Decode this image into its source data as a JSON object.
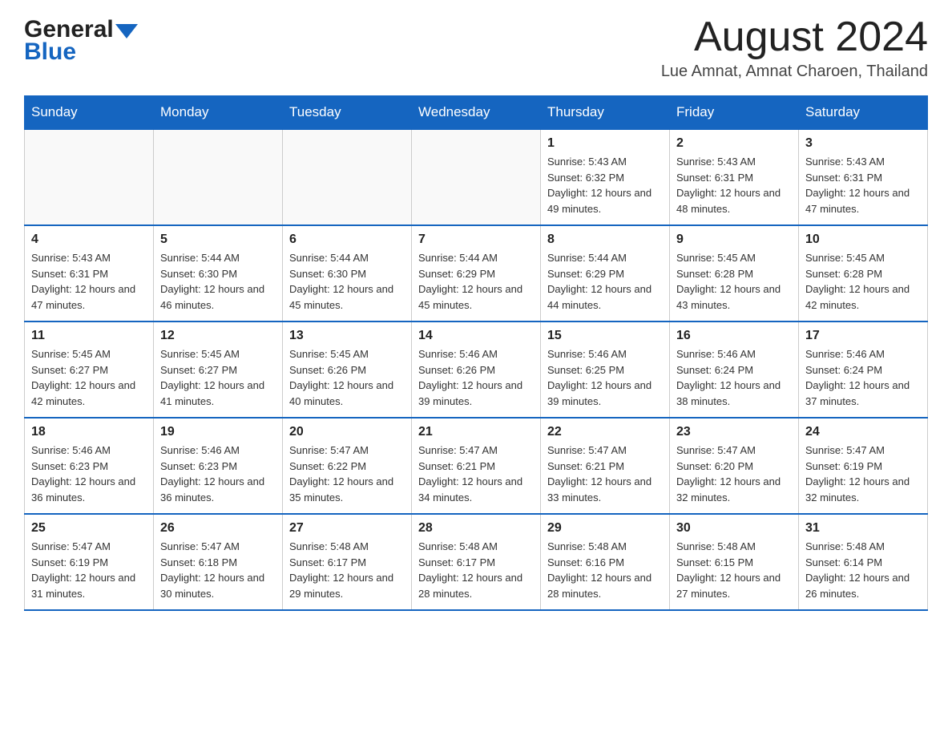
{
  "header": {
    "logo_general": "General",
    "logo_blue": "Blue",
    "month_title": "August 2024",
    "location": "Lue Amnat, Amnat Charoen, Thailand"
  },
  "days_of_week": [
    "Sunday",
    "Monday",
    "Tuesday",
    "Wednesday",
    "Thursday",
    "Friday",
    "Saturday"
  ],
  "weeks": [
    [
      {
        "day": "",
        "info": ""
      },
      {
        "day": "",
        "info": ""
      },
      {
        "day": "",
        "info": ""
      },
      {
        "day": "",
        "info": ""
      },
      {
        "day": "1",
        "info": "Sunrise: 5:43 AM\nSunset: 6:32 PM\nDaylight: 12 hours and 49 minutes."
      },
      {
        "day": "2",
        "info": "Sunrise: 5:43 AM\nSunset: 6:31 PM\nDaylight: 12 hours and 48 minutes."
      },
      {
        "day": "3",
        "info": "Sunrise: 5:43 AM\nSunset: 6:31 PM\nDaylight: 12 hours and 47 minutes."
      }
    ],
    [
      {
        "day": "4",
        "info": "Sunrise: 5:43 AM\nSunset: 6:31 PM\nDaylight: 12 hours and 47 minutes."
      },
      {
        "day": "5",
        "info": "Sunrise: 5:44 AM\nSunset: 6:30 PM\nDaylight: 12 hours and 46 minutes."
      },
      {
        "day": "6",
        "info": "Sunrise: 5:44 AM\nSunset: 6:30 PM\nDaylight: 12 hours and 45 minutes."
      },
      {
        "day": "7",
        "info": "Sunrise: 5:44 AM\nSunset: 6:29 PM\nDaylight: 12 hours and 45 minutes."
      },
      {
        "day": "8",
        "info": "Sunrise: 5:44 AM\nSunset: 6:29 PM\nDaylight: 12 hours and 44 minutes."
      },
      {
        "day": "9",
        "info": "Sunrise: 5:45 AM\nSunset: 6:28 PM\nDaylight: 12 hours and 43 minutes."
      },
      {
        "day": "10",
        "info": "Sunrise: 5:45 AM\nSunset: 6:28 PM\nDaylight: 12 hours and 42 minutes."
      }
    ],
    [
      {
        "day": "11",
        "info": "Sunrise: 5:45 AM\nSunset: 6:27 PM\nDaylight: 12 hours and 42 minutes."
      },
      {
        "day": "12",
        "info": "Sunrise: 5:45 AM\nSunset: 6:27 PM\nDaylight: 12 hours and 41 minutes."
      },
      {
        "day": "13",
        "info": "Sunrise: 5:45 AM\nSunset: 6:26 PM\nDaylight: 12 hours and 40 minutes."
      },
      {
        "day": "14",
        "info": "Sunrise: 5:46 AM\nSunset: 6:26 PM\nDaylight: 12 hours and 39 minutes."
      },
      {
        "day": "15",
        "info": "Sunrise: 5:46 AM\nSunset: 6:25 PM\nDaylight: 12 hours and 39 minutes."
      },
      {
        "day": "16",
        "info": "Sunrise: 5:46 AM\nSunset: 6:24 PM\nDaylight: 12 hours and 38 minutes."
      },
      {
        "day": "17",
        "info": "Sunrise: 5:46 AM\nSunset: 6:24 PM\nDaylight: 12 hours and 37 minutes."
      }
    ],
    [
      {
        "day": "18",
        "info": "Sunrise: 5:46 AM\nSunset: 6:23 PM\nDaylight: 12 hours and 36 minutes."
      },
      {
        "day": "19",
        "info": "Sunrise: 5:46 AM\nSunset: 6:23 PM\nDaylight: 12 hours and 36 minutes."
      },
      {
        "day": "20",
        "info": "Sunrise: 5:47 AM\nSunset: 6:22 PM\nDaylight: 12 hours and 35 minutes."
      },
      {
        "day": "21",
        "info": "Sunrise: 5:47 AM\nSunset: 6:21 PM\nDaylight: 12 hours and 34 minutes."
      },
      {
        "day": "22",
        "info": "Sunrise: 5:47 AM\nSunset: 6:21 PM\nDaylight: 12 hours and 33 minutes."
      },
      {
        "day": "23",
        "info": "Sunrise: 5:47 AM\nSunset: 6:20 PM\nDaylight: 12 hours and 32 minutes."
      },
      {
        "day": "24",
        "info": "Sunrise: 5:47 AM\nSunset: 6:19 PM\nDaylight: 12 hours and 32 minutes."
      }
    ],
    [
      {
        "day": "25",
        "info": "Sunrise: 5:47 AM\nSunset: 6:19 PM\nDaylight: 12 hours and 31 minutes."
      },
      {
        "day": "26",
        "info": "Sunrise: 5:47 AM\nSunset: 6:18 PM\nDaylight: 12 hours and 30 minutes."
      },
      {
        "day": "27",
        "info": "Sunrise: 5:48 AM\nSunset: 6:17 PM\nDaylight: 12 hours and 29 minutes."
      },
      {
        "day": "28",
        "info": "Sunrise: 5:48 AM\nSunset: 6:17 PM\nDaylight: 12 hours and 28 minutes."
      },
      {
        "day": "29",
        "info": "Sunrise: 5:48 AM\nSunset: 6:16 PM\nDaylight: 12 hours and 28 minutes."
      },
      {
        "day": "30",
        "info": "Sunrise: 5:48 AM\nSunset: 6:15 PM\nDaylight: 12 hours and 27 minutes."
      },
      {
        "day": "31",
        "info": "Sunrise: 5:48 AM\nSunset: 6:14 PM\nDaylight: 12 hours and 26 minutes."
      }
    ]
  ]
}
